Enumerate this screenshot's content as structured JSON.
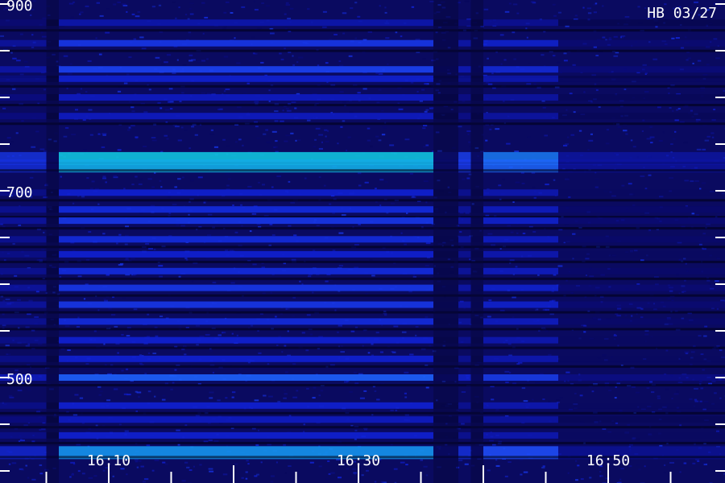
{
  "chart_data": {
    "type": "heatmap",
    "title": "",
    "station_label": "HB 03/27",
    "xlabel": "",
    "ylabel": "",
    "x_ticks": [
      "16:10",
      "16:30",
      "16:50"
    ],
    "y_ticks": [
      900,
      700,
      500
    ],
    "ylim": [
      410,
      900
    ],
    "xlim": [
      "16:00",
      "17:00"
    ],
    "grid": false,
    "colormap": [
      "#000000",
      "#0a0a7a",
      "#1020d0",
      "#2050ff",
      "#10c0e0",
      "#20ff90"
    ],
    "bands_hz": [
      {
        "f": 880,
        "intensity": 0.35
      },
      {
        "f": 858,
        "intensity": 0.55
      },
      {
        "f": 830,
        "intensity": 0.6
      },
      {
        "f": 820,
        "intensity": 0.45
      },
      {
        "f": 800,
        "intensity": 0.4
      },
      {
        "f": 780,
        "intensity": 0.4
      },
      {
        "f": 738,
        "intensity": 0.9
      },
      {
        "f": 730,
        "intensity": 0.85
      },
      {
        "f": 698,
        "intensity": 0.45
      },
      {
        "f": 680,
        "intensity": 0.5
      },
      {
        "f": 668,
        "intensity": 0.55
      },
      {
        "f": 648,
        "intensity": 0.5
      },
      {
        "f": 632,
        "intensity": 0.45
      },
      {
        "f": 614,
        "intensity": 0.5
      },
      {
        "f": 596,
        "intensity": 0.55
      },
      {
        "f": 578,
        "intensity": 0.55
      },
      {
        "f": 560,
        "intensity": 0.5
      },
      {
        "f": 540,
        "intensity": 0.45
      },
      {
        "f": 520,
        "intensity": 0.45
      },
      {
        "f": 500,
        "intensity": 0.7
      },
      {
        "f": 470,
        "intensity": 0.45
      },
      {
        "f": 455,
        "intensity": 0.4
      },
      {
        "f": 438,
        "intensity": 0.45
      },
      {
        "f": 423,
        "intensity": 0.8
      }
    ],
    "time_segments": [
      {
        "start": "16:00",
        "end": "16:05",
        "level": 0.55
      },
      {
        "start": "16:05",
        "end": "16:06",
        "level": 0.25
      },
      {
        "start": "16:06",
        "end": "16:36",
        "level": 0.9
      },
      {
        "start": "16:36",
        "end": "16:38",
        "level": 0.3
      },
      {
        "start": "16:38",
        "end": "16:39",
        "level": 0.6
      },
      {
        "start": "16:39",
        "end": "16:40",
        "level": 0.3
      },
      {
        "start": "16:40",
        "end": "16:46",
        "level": 0.75
      },
      {
        "start": "16:46",
        "end": "17:00",
        "level": 0.35
      }
    ]
  }
}
